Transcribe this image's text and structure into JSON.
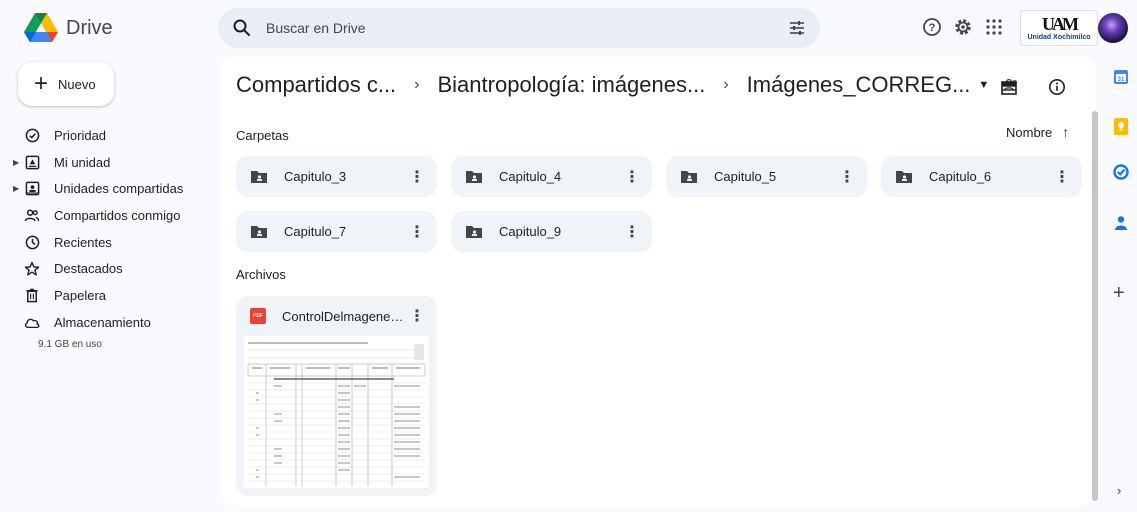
{
  "app": {
    "name": "Drive"
  },
  "search": {
    "placeholder": "Buscar en Drive"
  },
  "header": {
    "org_logo_mark": "UAM",
    "org_logo_name": "Unidad Xochimilco"
  },
  "sidebar": {
    "new_label": "Nuevo",
    "items": [
      {
        "label": "Prioridad",
        "icon": "check-circle-icon"
      },
      {
        "label": "Mi unidad",
        "icon": "my-drive-icon"
      },
      {
        "label": "Unidades compartidas",
        "icon": "shared-drives-icon"
      },
      {
        "label": "Compartidos conmigo",
        "icon": "people-icon"
      },
      {
        "label": "Recientes",
        "icon": "clock-icon"
      },
      {
        "label": "Destacados",
        "icon": "star-icon"
      },
      {
        "label": "Papelera",
        "icon": "trash-icon"
      },
      {
        "label": "Almacenamiento",
        "icon": "cloud-icon"
      }
    ],
    "storage_text": "9.1 GB en uso"
  },
  "breadcrumb": {
    "items": [
      "Compartidos c...",
      "Biantropología: imágenes...",
      "Imágenes_CORREG..."
    ],
    "separator": "›"
  },
  "sections": {
    "folders_label": "Carpetas",
    "files_label": "Archivos",
    "sort_label": "Nombre"
  },
  "folders": [
    {
      "name": "Capitulo_3"
    },
    {
      "name": "Capitulo_4"
    },
    {
      "name": "Capitulo_5"
    },
    {
      "name": "Capitulo_6"
    },
    {
      "name": "Capitulo_7"
    },
    {
      "name": "Capitulo_9"
    }
  ],
  "files": [
    {
      "name": "ControlDelmagenes...",
      "type_badge": "PDF"
    }
  ],
  "colors": {
    "accent": "#0b57d0",
    "surface": "#f0f4f9",
    "background": "#f8fafd",
    "pdf": "#ea4335"
  }
}
